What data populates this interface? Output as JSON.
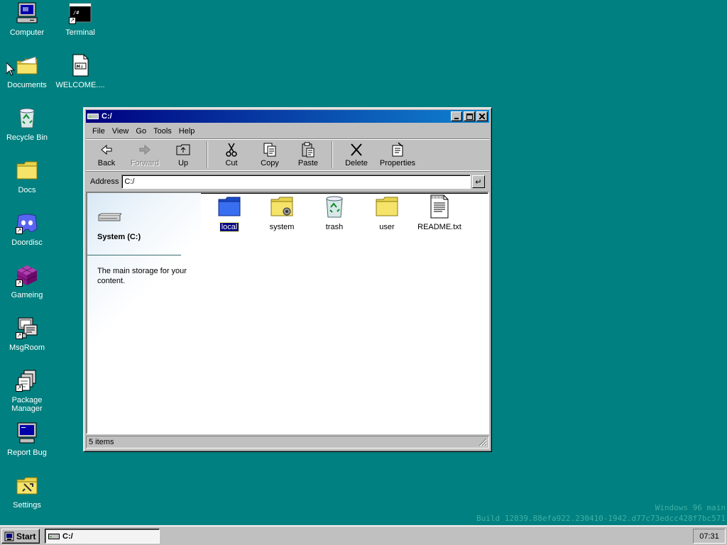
{
  "desktop": {
    "icons": [
      {
        "label": "Computer",
        "icon": "computer-icon"
      },
      {
        "label": "Terminal",
        "icon": "terminal-icon"
      },
      {
        "label": "Documents",
        "icon": "documents-folder-icon"
      },
      {
        "label": "WELCOME....",
        "icon": "markdown-file-icon"
      },
      {
        "label": "Recycle Bin",
        "icon": "recycle-bin-icon"
      },
      {
        "label": "Docs",
        "icon": "folder-icon"
      },
      {
        "label": "Doordisc",
        "icon": "doordisc-icon"
      },
      {
        "label": "Gameing",
        "icon": "game-cube-icon"
      },
      {
        "label": "MsgRoom",
        "icon": "msgroom-icon"
      },
      {
        "label": "Package Manager",
        "icon": "package-manager-icon"
      },
      {
        "label": "Report Bug",
        "icon": "report-bug-icon"
      },
      {
        "label": "Settings",
        "icon": "settings-icon"
      }
    ]
  },
  "window": {
    "title": "C:/",
    "menu": [
      "File",
      "View",
      "Go",
      "Tools",
      "Help"
    ],
    "toolbar": {
      "back": "Back",
      "forward": "Forward",
      "up": "Up",
      "cut": "Cut",
      "copy": "Copy",
      "paste": "Paste",
      "delete": "Delete",
      "properties": "Properties"
    },
    "address": {
      "label": "Address",
      "value": "C:/",
      "go": "↵"
    },
    "left_pane": {
      "title": "System (C:)",
      "description": "The main storage for your content."
    },
    "files": [
      {
        "name": "local",
        "icon": "blue-folder-icon",
        "selected": true
      },
      {
        "name": "system",
        "icon": "system-folder-icon",
        "selected": false
      },
      {
        "name": "trash",
        "icon": "recycle-bin-icon",
        "selected": false
      },
      {
        "name": "user",
        "icon": "folder-icon",
        "selected": false
      },
      {
        "name": "README.txt",
        "icon": "text-file-icon",
        "selected": false
      }
    ],
    "status": "5 items"
  },
  "watermark": {
    "line1": "Windows 96 main",
    "line2": "Build 12839.88efa922.230410-1942.d77c73edcc428f7bc571"
  },
  "taskbar": {
    "start_label": "Start",
    "task_title": "C:/",
    "clock": "07:31"
  },
  "colors": {
    "desktop": "#008080",
    "titlebar_start": "#000080",
    "titlebar_end": "#1084d0",
    "selection": "#000080"
  }
}
